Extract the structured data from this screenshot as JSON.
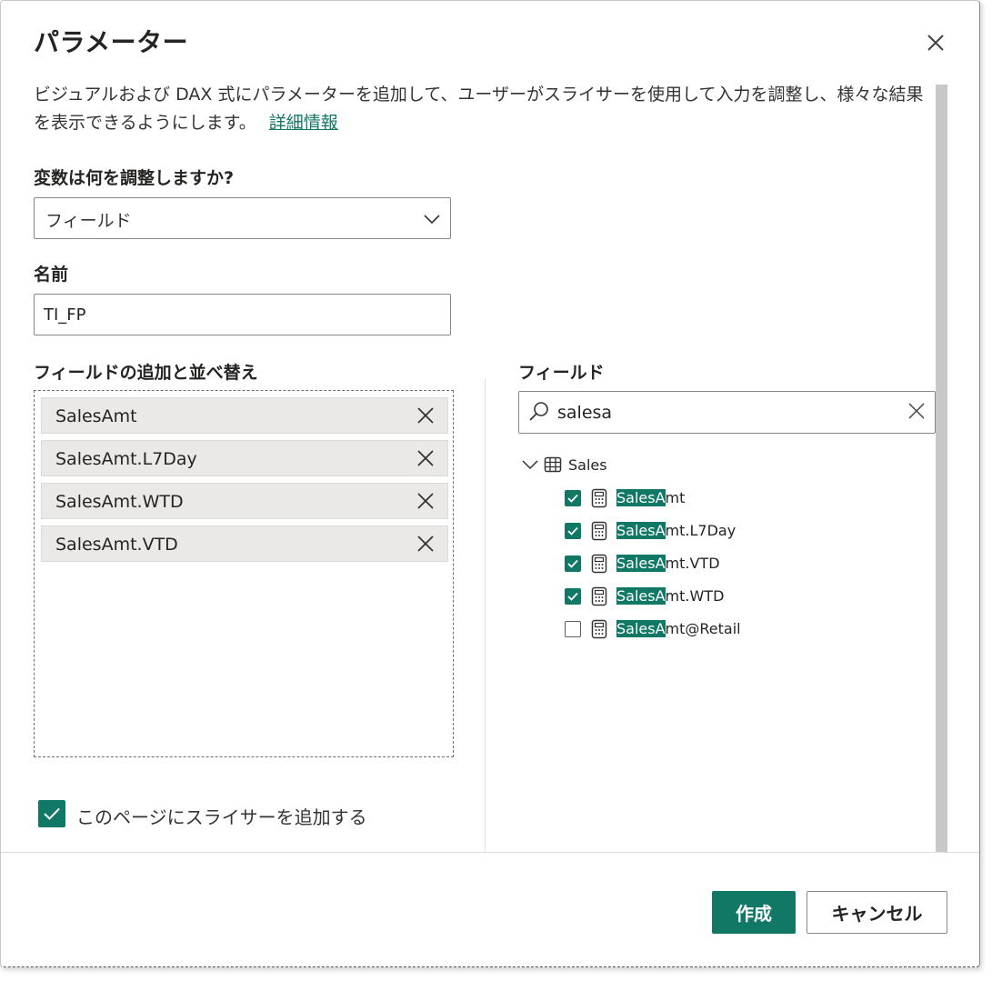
{
  "dialog": {
    "title": "パラメーター",
    "description": "ビジュアルおよび DAX 式にパラメーターを追加して、ユーザーがスライサーを使用して入力を調整し、様々な結果を表示できるようにします。",
    "learn_more": "詳細情報"
  },
  "form": {
    "variable_label": "変数は何を調整しますか?",
    "variable_value": "フィールド",
    "name_label": "名前",
    "name_value": "TI_FP",
    "add_sort_label": "フィールドの追加と並べ替え",
    "selected_fields": [
      "SalesAmt",
      "SalesAmt.L7Day",
      "SalesAmt.WTD",
      "SalesAmt.VTD"
    ]
  },
  "field_panel": {
    "label": "フィールド",
    "search_value": "salesa",
    "table_name": "Sales",
    "fields": [
      {
        "highlight": "SalesA",
        "rest": "mt",
        "checked": true
      },
      {
        "highlight": "SalesA",
        "rest": "mt.L7Day",
        "checked": true
      },
      {
        "highlight": "SalesA",
        "rest": "mt.VTD",
        "checked": true
      },
      {
        "highlight": "SalesA",
        "rest": "mt.WTD",
        "checked": true
      },
      {
        "highlight": "SalesA",
        "rest": "mt@Retail",
        "checked": false
      }
    ]
  },
  "footer": {
    "add_slicer_label": "このページにスライサーを追加する",
    "add_slicer_checked": true,
    "create_label": "作成",
    "cancel_label": "キャンセル"
  },
  "colors": {
    "accent": "#117865"
  }
}
